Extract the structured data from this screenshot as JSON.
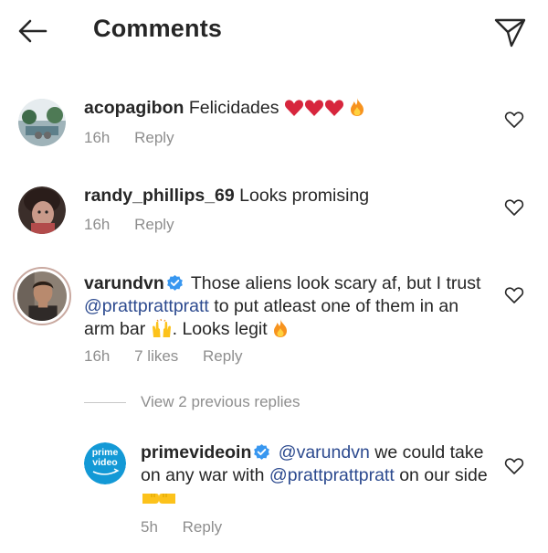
{
  "header": {
    "title": "Comments",
    "back_icon": "back-arrow-icon",
    "send_icon": "paper-plane-icon"
  },
  "comments": [
    {
      "username": "acopagibon",
      "text": "Felicidades",
      "emojis": [
        "red-heart",
        "red-heart",
        "red-heart",
        "fire"
      ],
      "time": "16h",
      "reply_label": "Reply"
    },
    {
      "username": "randy_phillips_69",
      "text": "Looks promising",
      "time": "16h",
      "reply_label": "Reply"
    },
    {
      "username": "varundvn",
      "verified": true,
      "text_parts": {
        "a": "Those aliens look scary af, but I trust",
        "mention": "@prattprattpratt",
        "b": "to put atleast one of them in an arm bar",
        "c": ". Looks legit"
      },
      "time": "16h",
      "likes": "7 likes",
      "reply_label": "Reply"
    }
  ],
  "view_replies": "View 2 previous replies",
  "reply": {
    "username": "primevideoin",
    "verified": true,
    "avatar_text": [
      "prime",
      "video"
    ],
    "text_parts": {
      "mention1": "@varundvn",
      "a": "we could take on any war with",
      "mention2": "@prattprattpratt",
      "b": "on our side"
    },
    "time": "5h",
    "reply_label": "Reply"
  },
  "colors": {
    "text": "#262626",
    "muted": "#8e8e8e",
    "mention": "#2c4a8f",
    "verified": "#3897f0",
    "heart": "#e0245e"
  }
}
